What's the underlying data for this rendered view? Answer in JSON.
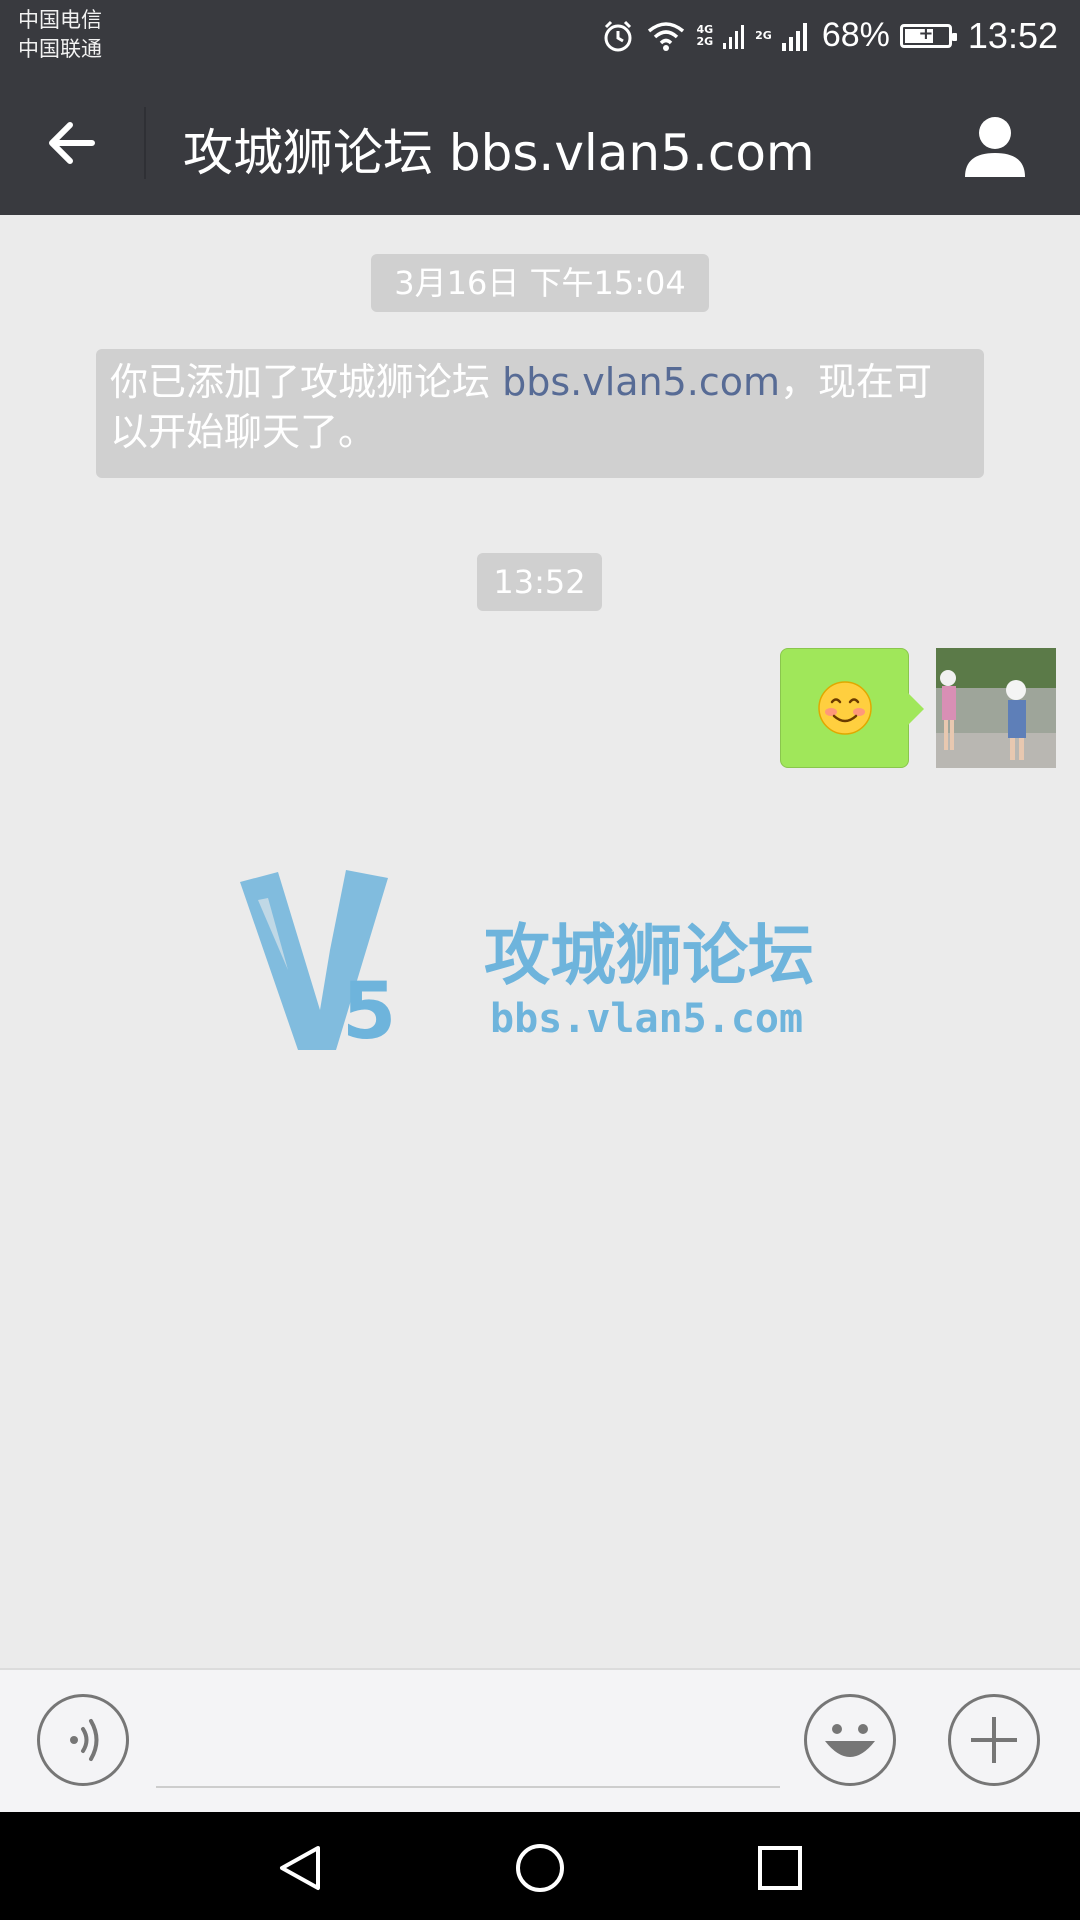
{
  "status_bar": {
    "carrier_1": "中国电信",
    "carrier_2": "中国联通",
    "signal_label_1": "4G",
    "signal_label_2": "2G",
    "signal_label_3": "2G",
    "battery_percent": "68%",
    "clock": "13:52"
  },
  "header": {
    "title": "攻城狮论坛 bbs.vlan5.com"
  },
  "chat": {
    "timestamp_1": "3月16日 下午15:04",
    "system_message_prefix": "你已添加了攻城狮论坛 ",
    "system_message_link": "bbs.vlan5.com",
    "system_message_suffix": "，现在可以开始聊天了。",
    "timestamp_2": "13:52",
    "sent_message_emoji": "😊"
  },
  "watermark": {
    "logo_mark": "V5",
    "name": "攻城狮论坛",
    "url": "bbs.vlan5.com"
  },
  "icons": {
    "back": "arrow-left-icon",
    "profile": "person-icon",
    "voice": "voice-icon",
    "emoji": "smiley-icon",
    "more": "plus-icon",
    "nav_back": "triangle-back-icon",
    "nav_home": "circle-home-icon",
    "nav_recent": "square-recent-icon"
  },
  "colors": {
    "bar": "#393a3f",
    "background": "#ebebeb",
    "bubble_sent": "#a0e75a",
    "link": "#576b95",
    "watermark": "#6eb4dc"
  }
}
